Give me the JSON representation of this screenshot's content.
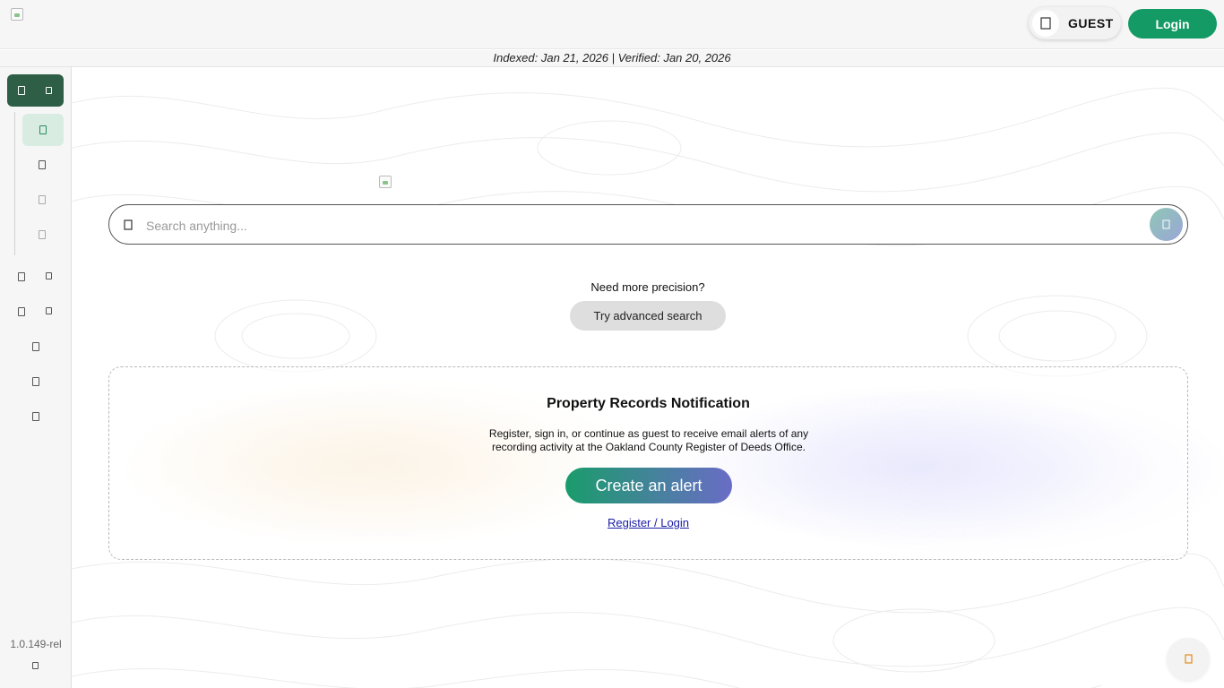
{
  "header": {
    "logo_icon": "broken-image-icon",
    "guest_label": "GUEST",
    "guest_icon": "user-icon",
    "login_label": "Login",
    "login_color": "#149a64"
  },
  "index_bar": {
    "text": "Indexed: Jan 21, 2026 | Verified: Jan 20, 2026"
  },
  "sidebar": {
    "active_color": "#2e5e46",
    "sub_active_color": "#d8ece1",
    "version": "1.0.149-rel"
  },
  "search": {
    "placeholder": "Search anything...",
    "icon": "search-icon",
    "submit_icon": "search-submit-icon"
  },
  "precision": {
    "prompt": "Need more precision?",
    "advanced_label": "Try advanced search"
  },
  "notification": {
    "title": "Property Records Notification",
    "body": "Register, sign in, or continue as guest to receive email alerts of any recording activity at the Oakland County Register of Deeds Office.",
    "cta_label": "Create an alert",
    "link_label": "Register / Login"
  },
  "help": {
    "icon": "help-chat-icon"
  }
}
